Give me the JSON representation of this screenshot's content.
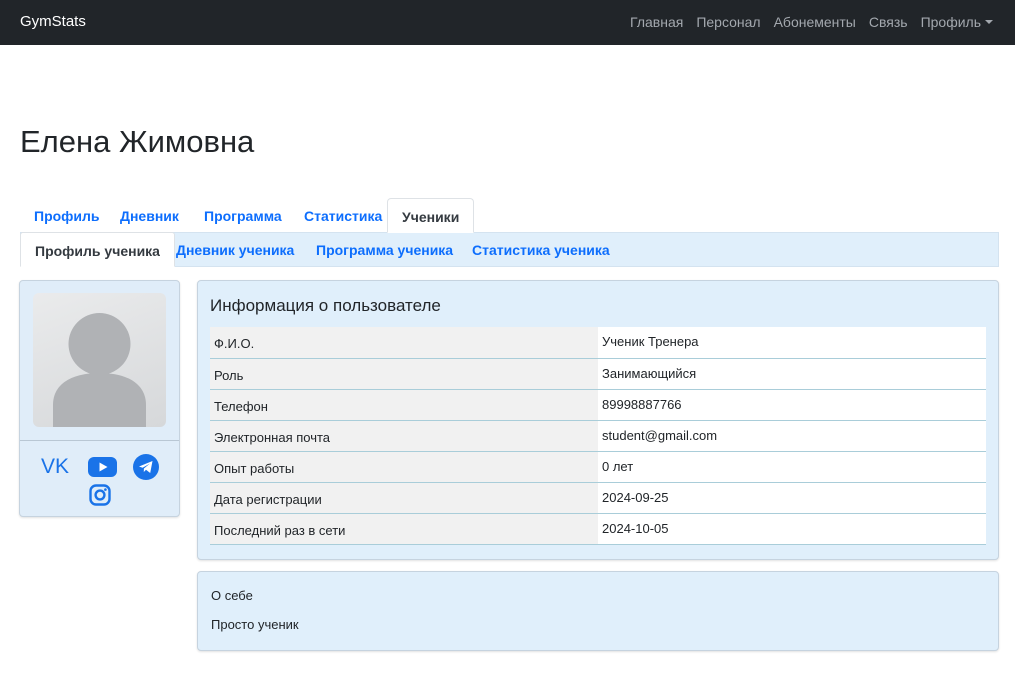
{
  "navbar": {
    "brand": "GymStats",
    "links": [
      "Главная",
      "Персонал",
      "Абонементы",
      "Связь"
    ],
    "profile_label": "Профиль"
  },
  "page": {
    "title": "Елена Жимовна"
  },
  "tabs": [
    "Профиль",
    "Дневник",
    "Программа",
    "Статистика",
    "Ученики"
  ],
  "active_tab": "Ученики",
  "subtabs": [
    "Профиль ученика",
    "Дневник ученика",
    "Программа ученика",
    "Статистика ученика"
  ],
  "active_subtab": "Профиль ученика",
  "profile_card": {
    "social_icons": [
      "vk-icon",
      "youtube-icon",
      "telegram-icon",
      "instagram-icon"
    ],
    "vk_text": "VK"
  },
  "user_info": {
    "title": "Информация о пользователе",
    "rows": [
      {
        "label": "Ф.И.О.",
        "value": "Ученик Тренера"
      },
      {
        "label": "Роль",
        "value": "Занимающийся"
      },
      {
        "label": "Телефон",
        "value": "89998887766"
      },
      {
        "label": "Электронная почта",
        "value": "student@gmail.com"
      },
      {
        "label": "Опыт работы",
        "value": "0 лет"
      },
      {
        "label": "Дата регистрации",
        "value": "2024-09-25"
      },
      {
        "label": "Последний раз в сети",
        "value": "2024-10-05"
      }
    ]
  },
  "about": {
    "title": "О себе",
    "text": "Просто ученик"
  },
  "colors": {
    "navbar_bg": "#212529",
    "link_blue": "#0d6efd",
    "panel_bg": "#e0effb",
    "social_blue": "#1a73e8"
  }
}
